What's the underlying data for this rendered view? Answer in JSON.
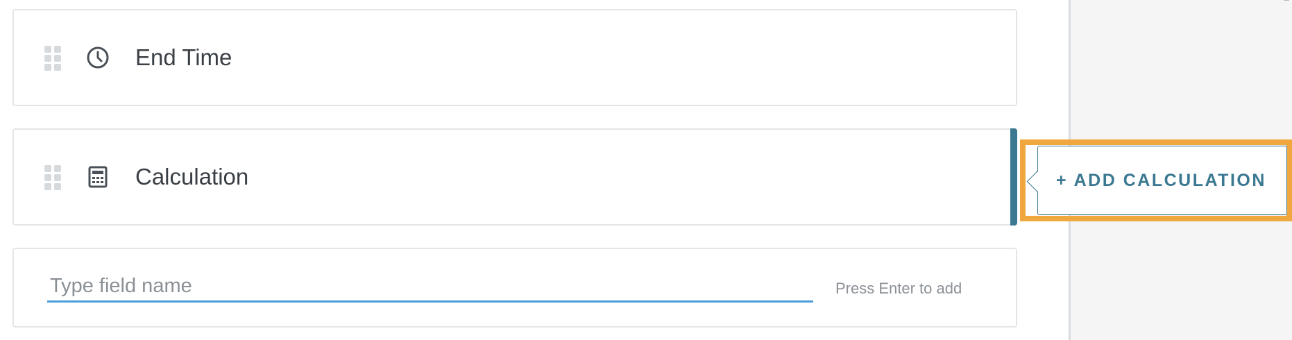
{
  "fields": [
    {
      "label": "End Time",
      "icon": "clock-icon"
    },
    {
      "label": "Calculation",
      "icon": "calculator-icon",
      "selected": true
    }
  ],
  "new_field": {
    "placeholder": "Type field name",
    "hint": "Press Enter to add"
  },
  "popover": {
    "add_label": "+ ADD CALCULATION"
  },
  "colors": {
    "accent": "#3b7891",
    "input_underline": "#4a9ed8",
    "highlight": "#f0a73e",
    "panel_bg": "#f5f5f6"
  }
}
